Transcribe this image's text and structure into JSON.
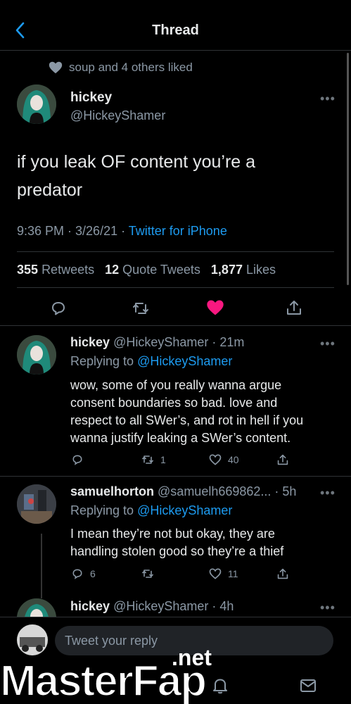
{
  "header": {
    "title": "Thread"
  },
  "main_tweet": {
    "liked_by": "soup and 4 others liked",
    "name": "hickey",
    "handle": "@HickeyShamer",
    "text_line1": "if you leak OF content you’re a",
    "text_line2": "predator",
    "time": "9:36 PM · 3/26/21 · ",
    "client": "Twitter for iPhone",
    "retweets_count": "355",
    "retweets_label": "Retweets",
    "quotes_count": "12",
    "quotes_label": "Quote Tweets",
    "likes_count": "1,877",
    "likes_label": "Likes",
    "liked": true,
    "like_color": "#f91880"
  },
  "replies": [
    {
      "name": "hickey",
      "handle_time": "@HickeyShamer · 21m",
      "replying_prefix": "Replying to ",
      "replying_to": "@HickeyShamer",
      "lines": [
        "wow, some of you really wanna argue",
        "consent boundaries so bad. love and",
        "respect to all SWer’s, and rot in hell if you",
        "wanna justify leaking a SWer’s content."
      ],
      "retweets": "1",
      "likes": "40"
    },
    {
      "name": "samuelhorton",
      "handle_time": "@samuelh669862... · 5h",
      "replying_prefix": "Replying to ",
      "replying_to": "@HickeyShamer",
      "lines": [
        "I mean they’re not but okay, they are",
        "handling stolen good so they’re a thief"
      ],
      "replies": "6",
      "likes": "11"
    },
    {
      "name": "hickey",
      "handle_time": "@HickeyShamer · 4h"
    }
  ],
  "reply_bar": {
    "placeholder": "Tweet your reply"
  },
  "watermark": {
    "text": "MasterFap",
    "suffix": ".net"
  },
  "colors": {
    "accent": "#1d9bf0",
    "muted": "#8b98a5",
    "like": "#f91880"
  }
}
